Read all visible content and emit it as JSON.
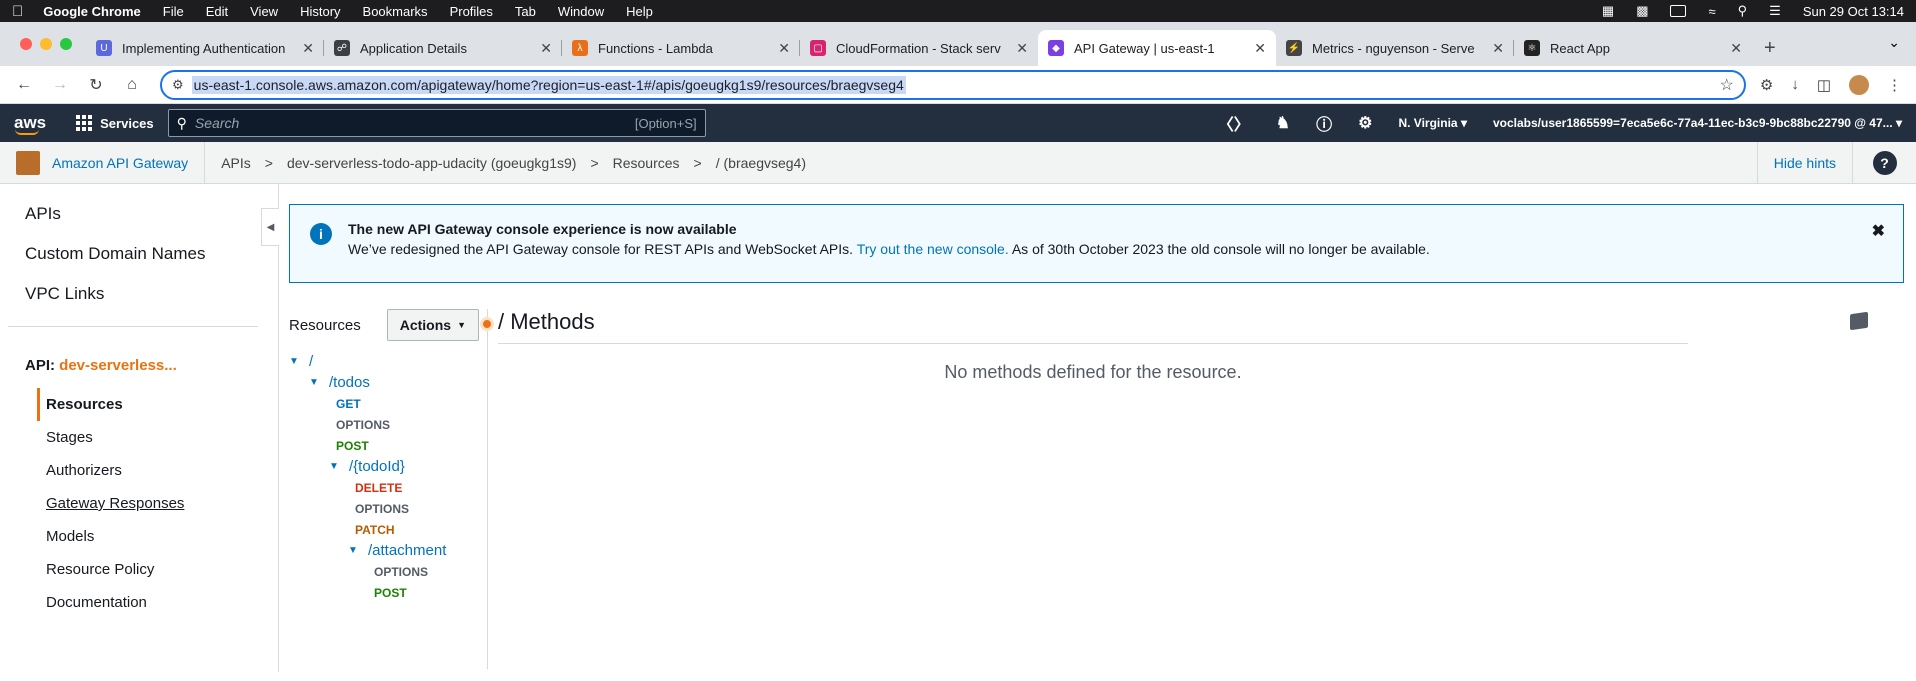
{
  "menubar": {
    "app_name": "Google Chrome",
    "items": [
      "File",
      "Edit",
      "View",
      "History",
      "Bookmarks",
      "Profiles",
      "Tab",
      "Window",
      "Help"
    ],
    "clock": "Sun 29 Oct  13:14"
  },
  "tabs": [
    {
      "title": "Implementing Authentication",
      "icon": "udacity-icon",
      "color": "#5c68dc"
    },
    {
      "title": "Application Details",
      "icon": "shield-icon",
      "color": "#3c4043"
    },
    {
      "title": "Functions - Lambda",
      "icon": "lambda-icon",
      "color": "#e8701a"
    },
    {
      "title": "CloudFormation - Stack serv",
      "icon": "cloudformation-icon",
      "color": "#d6246e"
    },
    {
      "title": "API Gateway | us-east-1",
      "icon": "api-gateway-icon",
      "color": "#7b3fe4",
      "active": true
    },
    {
      "title": "Metrics - nguyenson - Serve",
      "icon": "serverless-icon",
      "color": "#444"
    },
    {
      "title": "React App",
      "icon": "react-icon",
      "color": "#222"
    }
  ],
  "address": {
    "url": "us-east-1.console.aws.amazon.com/apigateway/home?region=us-east-1#/apis/goeugkg1s9/resources/braegvseg4"
  },
  "aws": {
    "logo": "aws",
    "services_label": "Services",
    "search_placeholder": "Search",
    "search_shortcut": "[Option+S]",
    "region": "N. Virginia",
    "account": "voclabs/user1865599=7eca5e6c-77a4-11ec-b3c9-9bc88bc22790 @ 47..."
  },
  "breadcrumb": {
    "service": "Amazon API Gateway",
    "items": [
      "APIs",
      "dev-serverless-todo-app-udacity (goeugkg1s9)",
      "Resources",
      "/ (braegvseg4)"
    ],
    "hide_hints": "Hide hints",
    "help": "?"
  },
  "leftnav": {
    "top_items": [
      "APIs",
      "Custom Domain Names",
      "VPC Links"
    ],
    "api_label": "API:",
    "api_name": "dev-serverless...",
    "sub_items": [
      "Resources",
      "Stages",
      "Authorizers",
      "Gateway Responses",
      "Models",
      "Resource Policy",
      "Documentation"
    ]
  },
  "banner": {
    "title": "The new API Gateway console experience is now available",
    "body_before": "We’ve redesigned the API Gateway console for REST APIs and WebSocket APIs. ",
    "link": "Try out the new console.",
    "body_after": " As of 30th October 2023 the old console will no longer be available."
  },
  "resources": {
    "label": "Resources",
    "actions": "Actions",
    "tree": [
      {
        "path": "/",
        "level": 0,
        "methods": []
      },
      {
        "path": "/todos",
        "level": 1,
        "methods": [
          "GET",
          "OPTIONS",
          "POST"
        ]
      },
      {
        "path": "/{todoId}",
        "level": 2,
        "methods": [
          "DELETE",
          "OPTIONS",
          "PATCH"
        ]
      },
      {
        "path": "/attachment",
        "level": 3,
        "methods": [
          "OPTIONS",
          "POST"
        ]
      }
    ]
  },
  "methods": {
    "heading": "/ Methods",
    "empty": "No methods defined for the resource."
  }
}
